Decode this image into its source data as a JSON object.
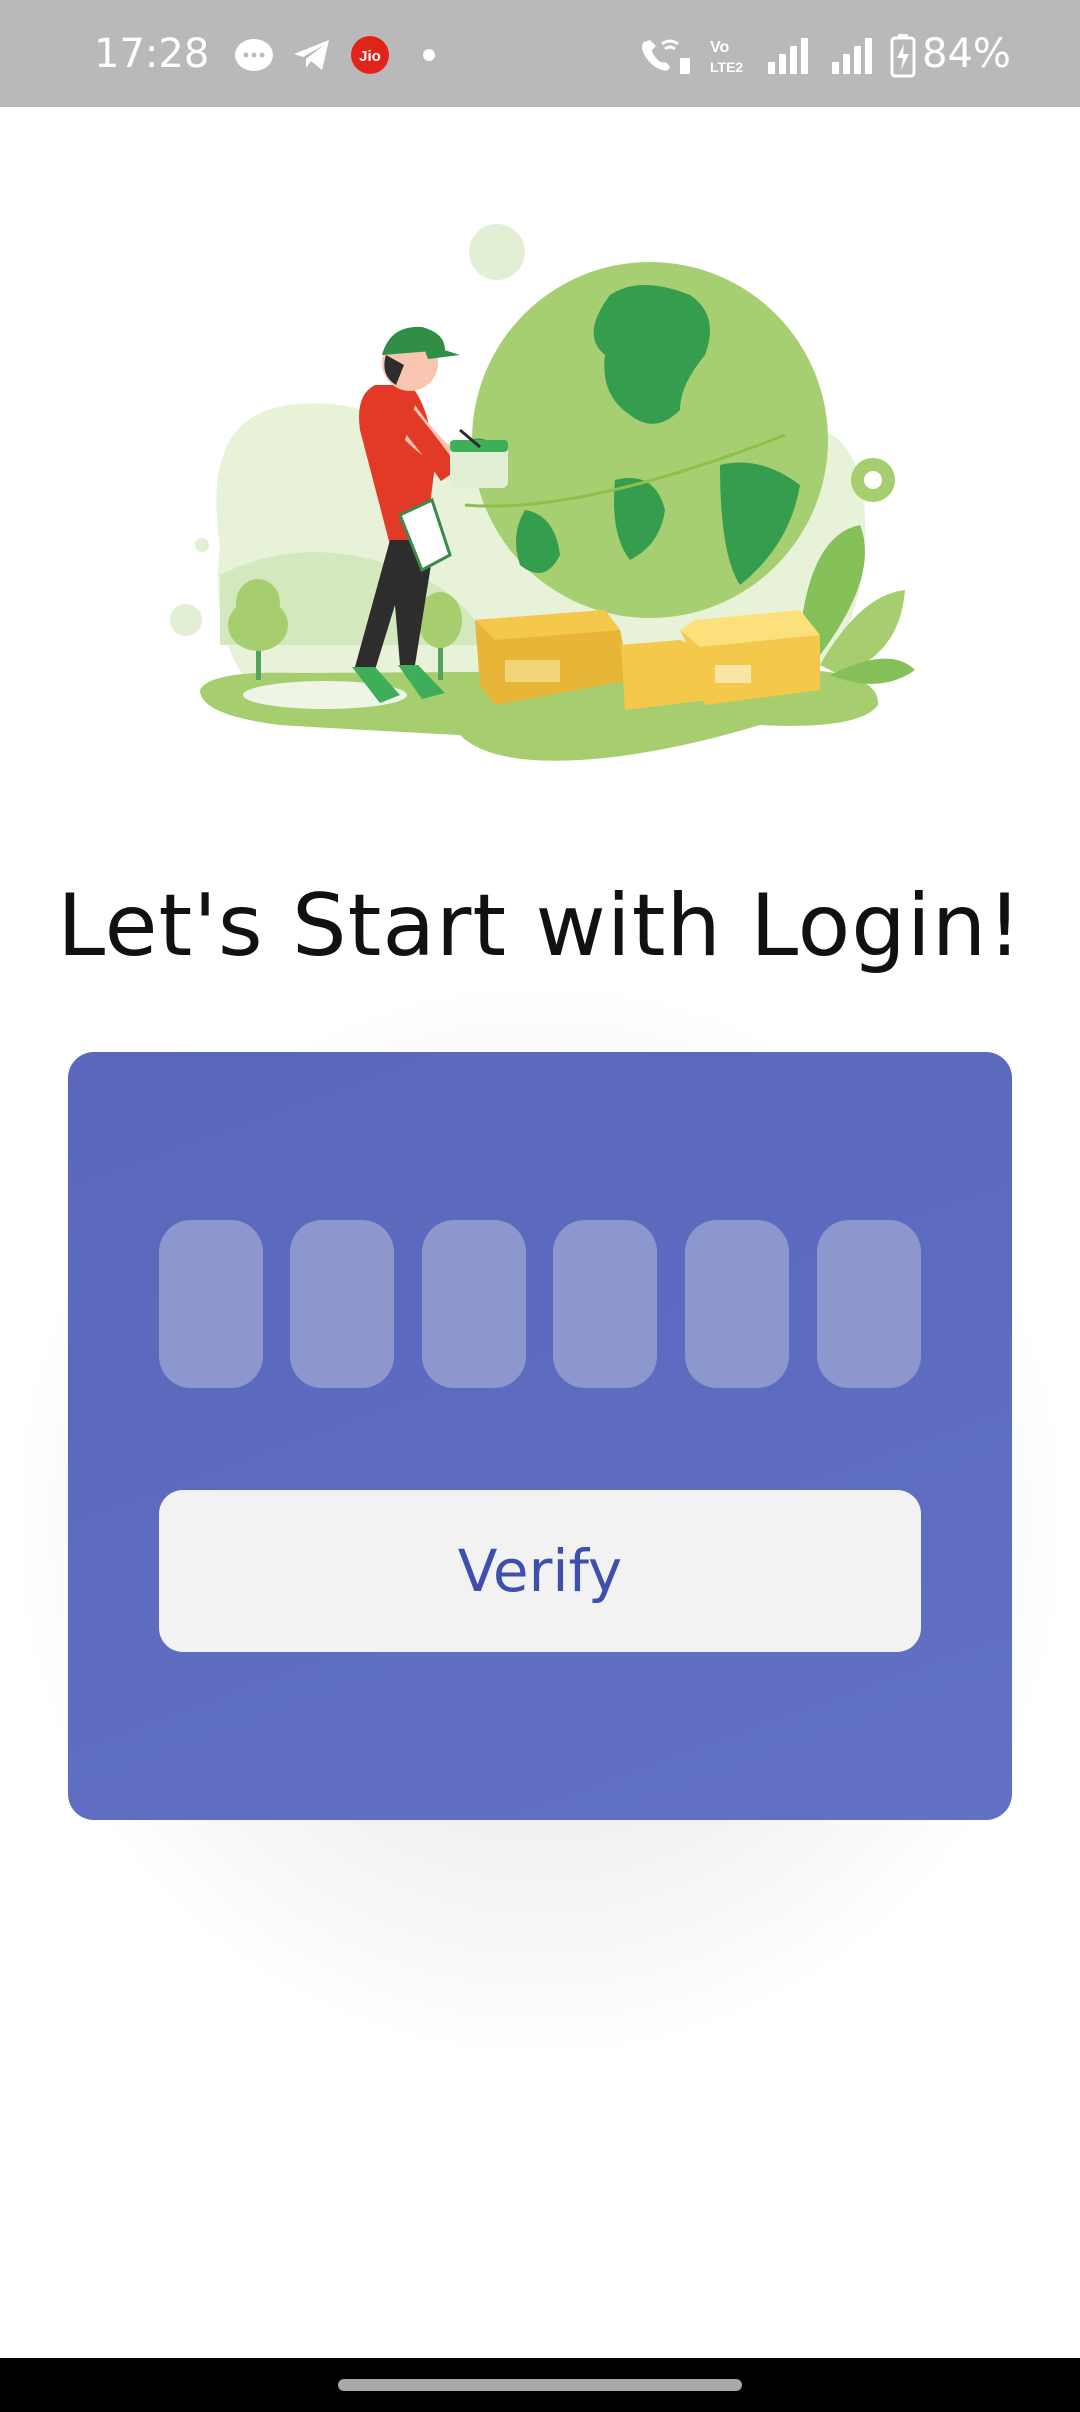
{
  "status_bar": {
    "time": "17:28",
    "notification_icons": [
      "chat-bubble-icon",
      "telegram-icon",
      "jio-icon",
      "dot-icon"
    ],
    "jio_label": "Jio",
    "system_icons": [
      "wifi-calling-icon",
      "volte2-icon",
      "signal-1-icon",
      "signal-2-icon",
      "battery-charging-icon"
    ],
    "volte_label": "Vo LTE2",
    "battery": "84%"
  },
  "illustration": {
    "name": "delivery-man-globe-illustration"
  },
  "login": {
    "title": "Let's Start with Login!",
    "otp_digits": [
      "",
      "",
      "",
      "",
      "",
      ""
    ],
    "verify_label": "Verify"
  },
  "colors": {
    "card": "#5d6cc0",
    "otp_box": "#8b97cd",
    "button_bg": "#f2f2f2",
    "button_text": "#3e4fae",
    "status_bar": "#b9b9b9"
  }
}
